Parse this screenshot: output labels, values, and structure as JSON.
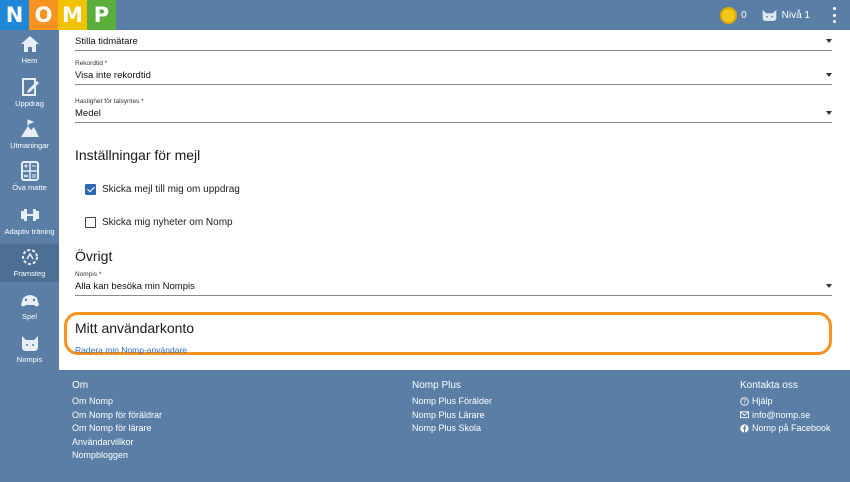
{
  "logo": {
    "letters": [
      {
        "char": "N",
        "color": "#1e88d6"
      },
      {
        "char": "O",
        "color": "#f7931e"
      },
      {
        "char": "M",
        "color": "#f2c200"
      },
      {
        "char": "P",
        "color": "#5aae3c"
      }
    ]
  },
  "topbar": {
    "coin_icon": "coin-icon",
    "coin_count": "0",
    "level_icon": "cat-face-icon",
    "level": "Nivå 1",
    "menu_icon": "kebab-menu-icon"
  },
  "sidebar": {
    "items": [
      {
        "label": "Hem",
        "icon": "home-icon"
      },
      {
        "label": "Uppdrag",
        "icon": "pencil-paper-icon"
      },
      {
        "label": "Utmaningar",
        "icon": "mountain-flag-icon"
      },
      {
        "label": "Öva matte",
        "icon": "calculator-icon"
      },
      {
        "label": "Adaptiv träning",
        "icon": "dumbbell-icon"
      },
      {
        "label": "Framsteg",
        "icon": "progress-circle-icon"
      },
      {
        "label": "Spel",
        "icon": "game-controller-icon"
      },
      {
        "label": "Nompis",
        "icon": "cat-face-icon"
      }
    ]
  },
  "settings": {
    "timer": {
      "value": "Stilla tidmätare"
    },
    "record": {
      "label": "Rekordtid *",
      "value": "Visa inte rekordtid"
    },
    "speech": {
      "label": "Hastighet för talsyntes *",
      "value": "Medel"
    },
    "email_section": {
      "title": "Inställningar för mejl",
      "options": [
        {
          "label": "Skicka mejl till mig om uppdrag",
          "checked": true
        },
        {
          "label": "Skicka mig nyheter om Nomp",
          "checked": false
        }
      ]
    },
    "other_section": {
      "title": "Övrigt",
      "nompis": {
        "label": "Nompis *",
        "value": "Alla kan besöka min Nompis"
      }
    },
    "account_section": {
      "title": "Mitt användarkonto",
      "delete_link": "Radera min Nomp-användare",
      "highlight_color": "#f7931e"
    }
  },
  "footer": {
    "about": {
      "title": "Om",
      "links": [
        "Om Nomp",
        "Om Nomp för föräldrar",
        "Om Nomp för lärare",
        "Användarvillkor",
        "Nompbloggen"
      ]
    },
    "plus": {
      "title": "Nomp Plus",
      "links": [
        "Nomp Plus Förälder",
        "Nomp Plus Lärare",
        "Nomp Plus Skola"
      ]
    },
    "contact": {
      "title": "Kontakta oss",
      "links": [
        {
          "label": "Hjälp",
          "icon": "question-circle-icon"
        },
        {
          "label": "info@nomp.se",
          "icon": "envelope-icon"
        },
        {
          "label": "Nomp på Facebook",
          "icon": "facebook-icon"
        }
      ]
    }
  }
}
